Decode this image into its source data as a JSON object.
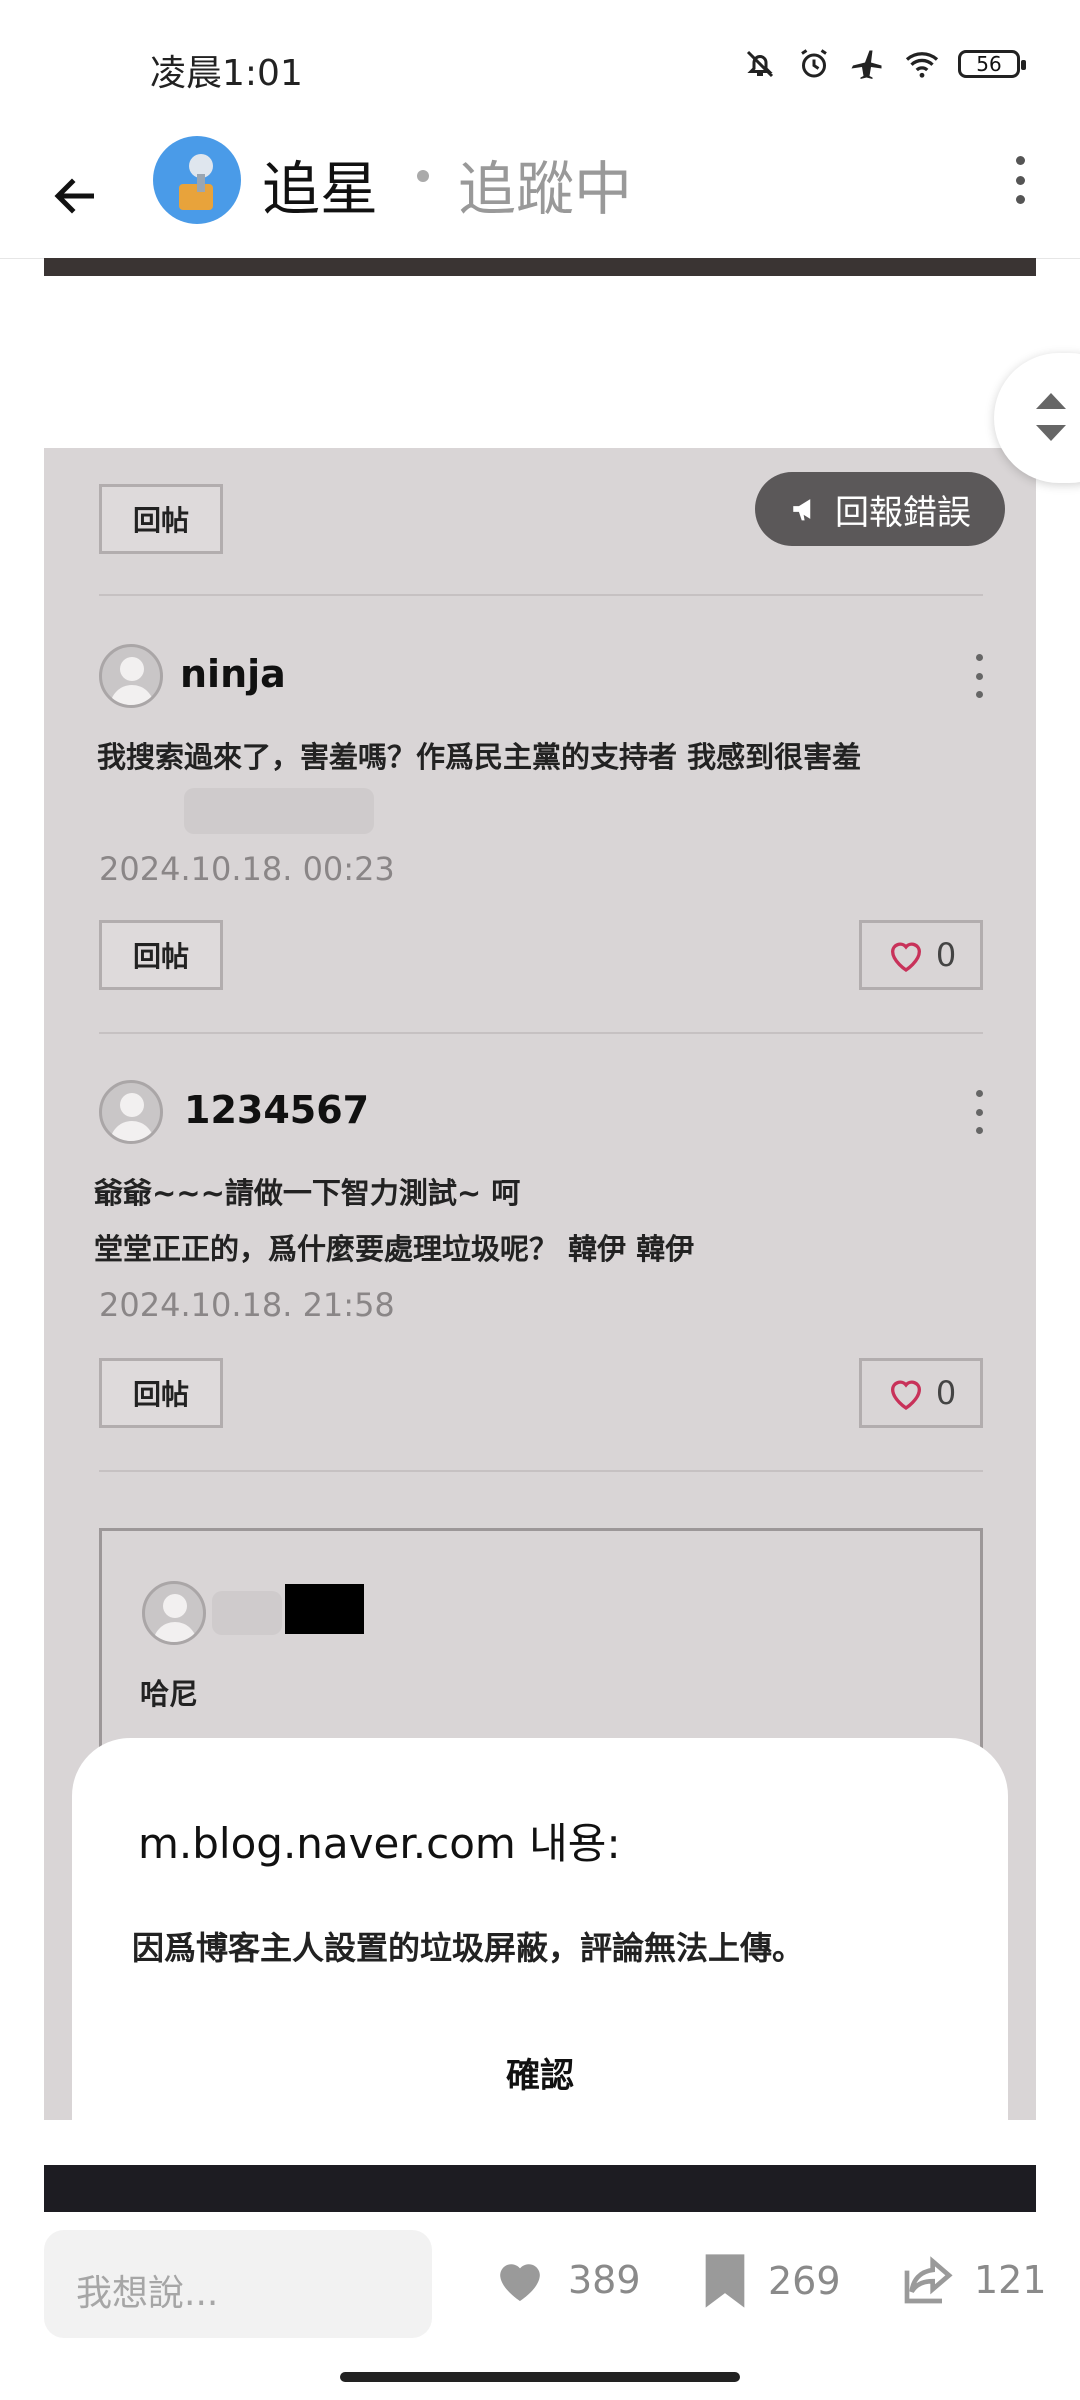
{
  "status_bar": {
    "time": "凌晨1:01",
    "battery": "56"
  },
  "header": {
    "title": "追星",
    "follow_status": "追蹤中"
  },
  "report_button": {
    "label": "回報錯誤"
  },
  "reply_label": "回帖",
  "comments": [
    {
      "user": "ninja",
      "lines": [
        "我搜索過來了，害羞嗎？作爲民主黨的支持者 我感到很害羞"
      ],
      "date": "2024.10.18. 00:23",
      "reply_label": "回帖",
      "likes": "0"
    },
    {
      "user": "1234567",
      "lines": [
        "爺爺~~~請做一下智力測試~ 呵",
        "堂堂正正的，爲什麼要處理垃圾呢？ 韓伊 韓伊"
      ],
      "date": "2024.10.18. 21:58",
      "reply_label": "回帖",
      "likes": "0"
    }
  ],
  "reply_card": {
    "text": "哈尼"
  },
  "dialog": {
    "title": "m.blog.naver.com 내용:",
    "message": "因爲博客主人設置的垃圾屏蔽，評論無法上傳。",
    "ok": "確認"
  },
  "bottom_bar": {
    "compose_placeholder": "我想說...",
    "likes": "389",
    "bookmarks": "269",
    "shares": "121"
  }
}
